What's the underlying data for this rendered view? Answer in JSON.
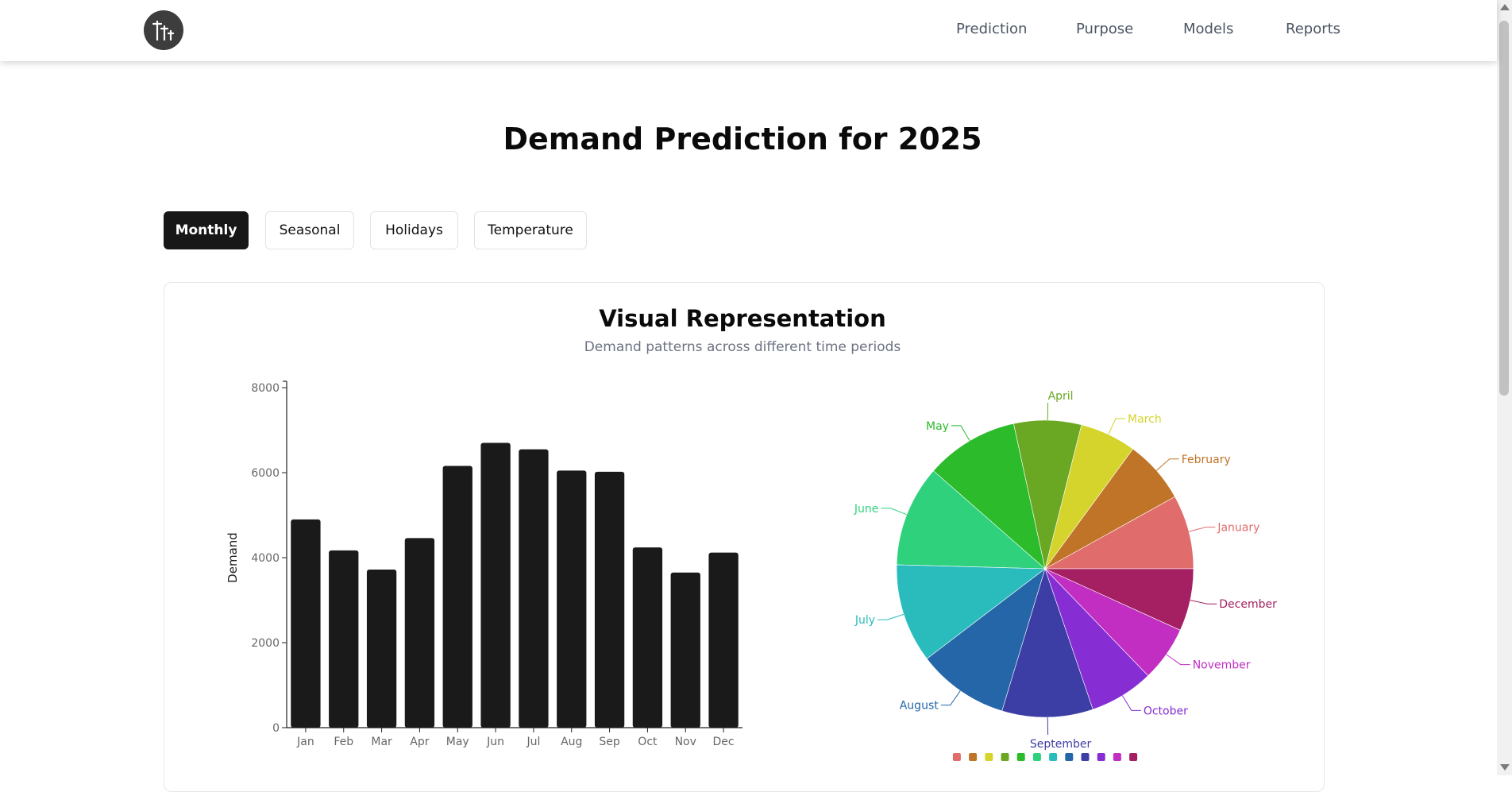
{
  "header": {
    "nav": [
      "Prediction",
      "Purpose",
      "Models",
      "Reports"
    ]
  },
  "page": {
    "title": "Demand Prediction for 2025"
  },
  "tabs": [
    {
      "label": "Monthly",
      "active": true
    },
    {
      "label": "Seasonal",
      "active": false
    },
    {
      "label": "Holidays",
      "active": false
    },
    {
      "label": "Temperature",
      "active": false
    }
  ],
  "card": {
    "title": "Visual Representation",
    "subtitle": "Demand patterns across different time periods"
  },
  "colors": {
    "bar": "#1a1a1a",
    "active_tab": "#171717",
    "pie": [
      "#e06c6c",
      "#bf7428",
      "#d4d42c",
      "#6aa823",
      "#2bbb2b",
      "#2fd17c",
      "#2abcbc",
      "#2466a8",
      "#3d3da6",
      "#862dd4",
      "#c22ec2",
      "#a42062"
    ]
  },
  "chart_data": [
    {
      "type": "bar",
      "categories": [
        "Jan",
        "Feb",
        "Mar",
        "Apr",
        "May",
        "Jun",
        "Jul",
        "Aug",
        "Sep",
        "Oct",
        "Nov",
        "Dec"
      ],
      "values": [
        4900,
        4170,
        3720,
        4460,
        6160,
        6700,
        6550,
        6050,
        6020,
        4240,
        3650,
        4120
      ],
      "ylabel": "Demand",
      "ylim": [
        0,
        8000
      ],
      "yticks": [
        0,
        2000,
        4000,
        6000,
        8000
      ],
      "grid": false
    },
    {
      "type": "pie",
      "labels": [
        "January",
        "February",
        "March",
        "April",
        "May",
        "June",
        "July",
        "August",
        "September",
        "October",
        "November",
        "December"
      ],
      "values": [
        4900,
        4170,
        3720,
        4460,
        6160,
        6700,
        6550,
        6050,
        6020,
        4240,
        3650,
        4120
      ],
      "legend_placement": "bottom"
    }
  ]
}
